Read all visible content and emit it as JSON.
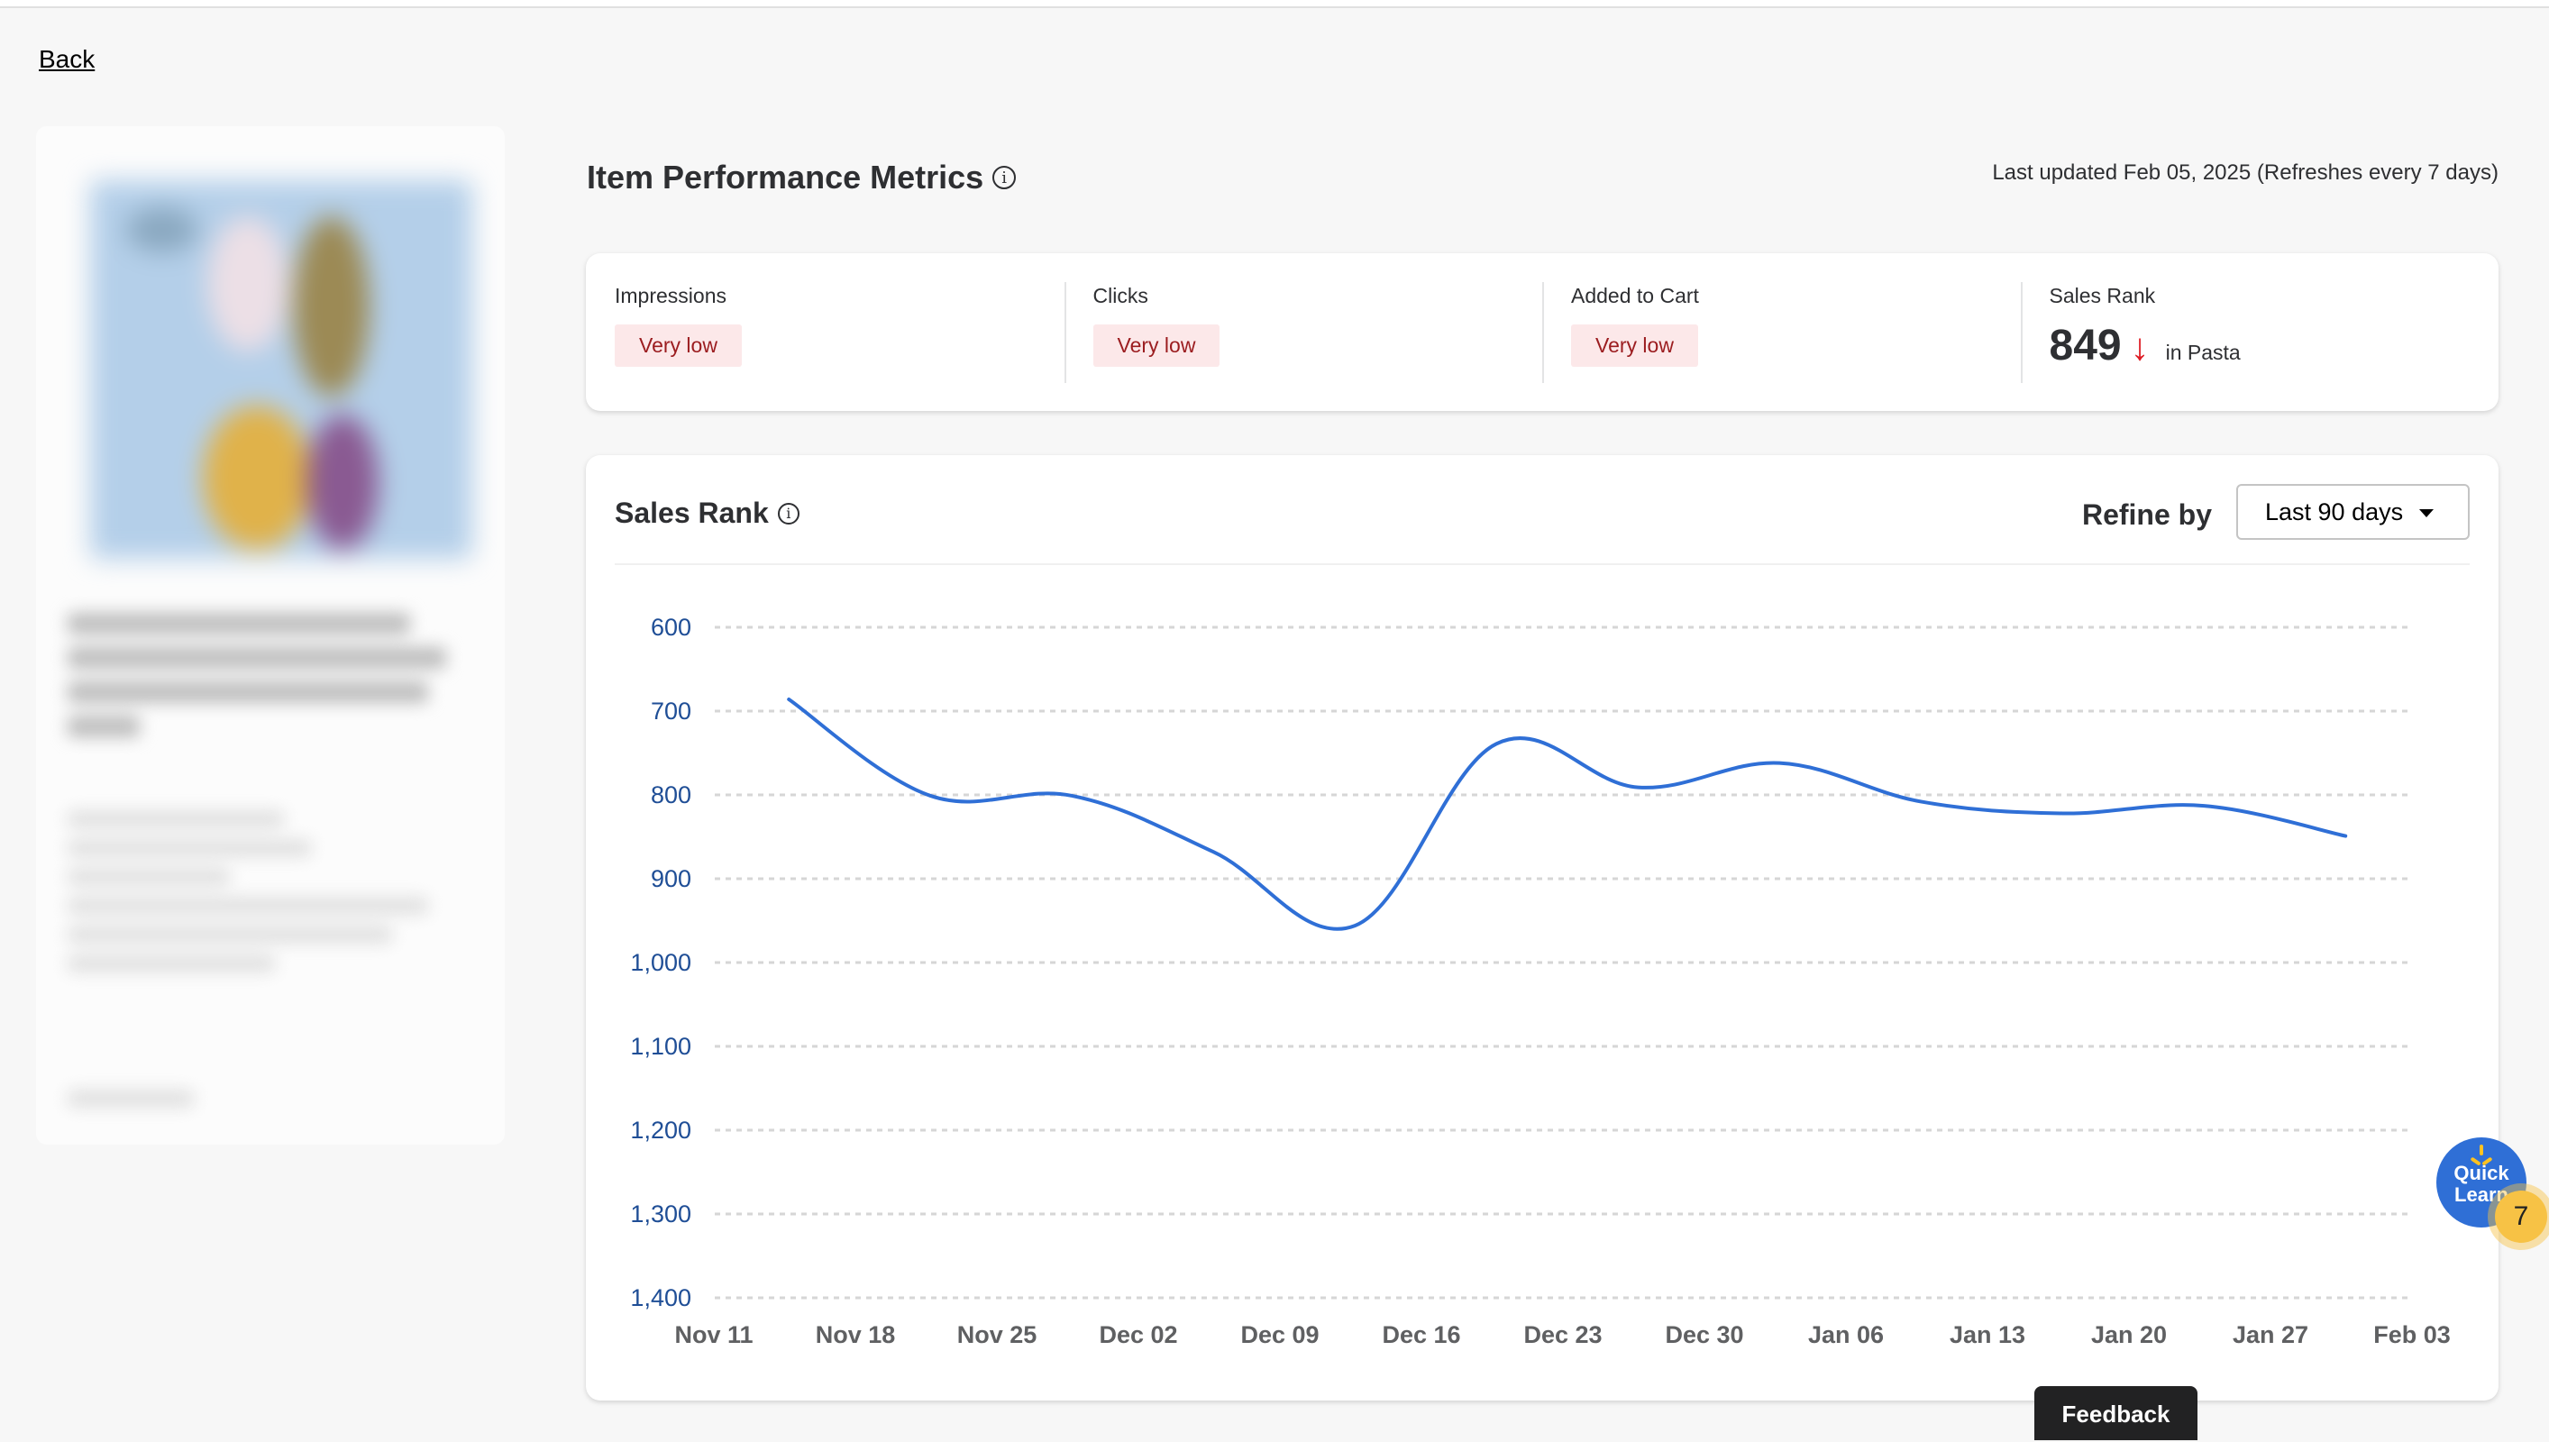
{
  "nav": {
    "back_label": "Back"
  },
  "header": {
    "title": "Item Performance Metrics",
    "last_updated": "Last updated Feb 05, 2025 (Refreshes every 7 days)"
  },
  "metrics": {
    "impressions": {
      "label": "Impressions",
      "status": "Very low"
    },
    "clicks": {
      "label": "Clicks",
      "status": "Very low"
    },
    "added_to_cart": {
      "label": "Added to Cart",
      "status": "Very low"
    },
    "sales_rank": {
      "label": "Sales Rank",
      "value": "849",
      "trend": "down",
      "trend_glyph": "↓",
      "context": "in Pasta"
    }
  },
  "chart_section": {
    "title": "Sales Rank",
    "refine_label": "Refine by",
    "refine_selected": "Last 90 days"
  },
  "widgets": {
    "quick_learn_line1": "Quick",
    "quick_learn_line2": "Learn",
    "quick_learn_badge": "7",
    "feedback_label": "Feedback"
  },
  "colors": {
    "line": "#2f6fd6",
    "y_tick": "#1f4e96",
    "x_tick": "#5f6062",
    "grid": "#d6d6d6",
    "badge_bg": "#fce8e9",
    "badge_text": "#9b1c1f",
    "trend_down": "#de1c24"
  },
  "chart_data": {
    "type": "line",
    "title": "Sales Rank",
    "xlabel": "",
    "ylabel": "",
    "x_tick_labels": [
      "Nov 11",
      "Nov 18",
      "Nov 25",
      "Dec 02",
      "Dec 09",
      "Dec 16",
      "Dec 23",
      "Dec 30",
      "Jan 06",
      "Jan 13",
      "Jan 20",
      "Jan 27",
      "Feb 03"
    ],
    "y_tick_labels": [
      "600",
      "700",
      "800",
      "900",
      "1,000",
      "1,100",
      "1,200",
      "1,300",
      "1,400"
    ],
    "y_ticks": [
      600,
      700,
      800,
      900,
      1000,
      1100,
      1200,
      1300,
      1400
    ],
    "ylim": [
      600,
      1400
    ],
    "y_inverted": true,
    "grid": "horizontal-dashed",
    "x_offset_weeks": 0.53,
    "series": [
      {
        "name": "Sales Rank",
        "values": [
          686,
          801,
          801,
          868,
          956,
          739,
          791,
          762,
          808,
          822,
          813,
          849
        ]
      }
    ]
  }
}
